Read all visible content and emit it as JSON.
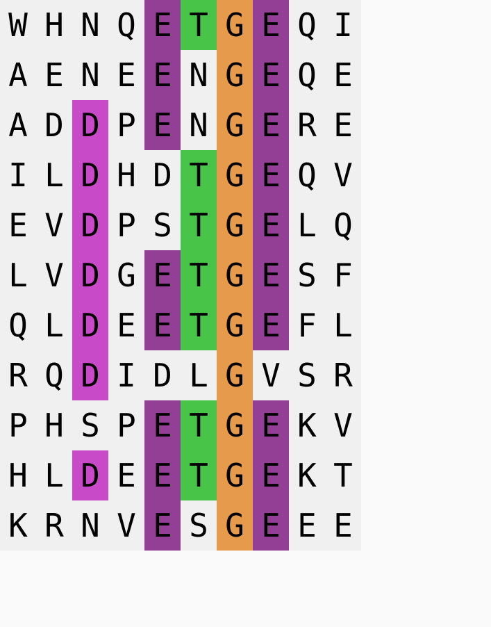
{
  "alignment": {
    "rows": [
      "WHNQETGEQI",
      "AENEENGEQE",
      "ADDPENGERE",
      "ILDHDTGEQV",
      "EVDPSTGELQ",
      "LVDGETGESF",
      "QLDEETGEFL",
      "RQDIDLGVSR",
      "PHSPETGEKV",
      "HLDEETGEKT",
      "KRNVESGEEE"
    ],
    "highlight": [
      "....CBAC..",
      "....C.AC..",
      "..D.C.AC..",
      "..D..BAC..",
      "..D..BAC..",
      "..D.CBAC..",
      "..D.CBAC..",
      "..D...A...",
      "....CBAC..",
      "..D.CBAC..",
      "....C.AC.."
    ]
  },
  "colors": {
    "background": "#f0f0f0",
    "A": "#e69a4b",
    "B": "#48c548",
    "C": "#943f96",
    "D": "#c84ac8"
  }
}
